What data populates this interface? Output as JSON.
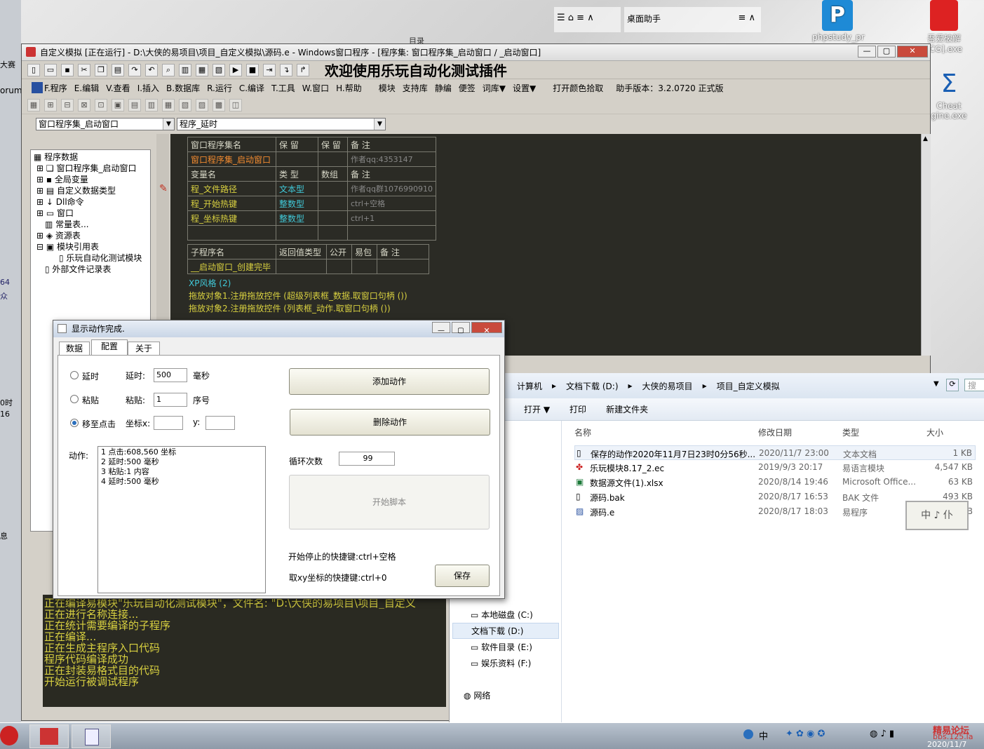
{
  "desktop": {
    "icons": [
      {
        "label": "phpstudy_pr"
      },
      {
        "label": "吾爱破解"
      },
      {
        "label": "[CG].exe"
      },
      {
        "label": "Cheat"
      },
      {
        "label": "gine.exe"
      }
    ],
    "top_label": "目录",
    "assistant_label": "桌面助手",
    "left_fragments": [
      "大赛(窦",
      "orum",
      "64",
      "众",
      "0时",
      "16",
      "息"
    ]
  },
  "ide": {
    "title": "自定义模拟 [正在运行] - D:\\大侠的易项目\\项目_自定义模拟\\源码.e - Windows窗口程序 - [程序集: 窗口程序集_启动窗口 / _启动窗口]",
    "banner": "欢迎使用乐玩自动化测试插件",
    "menu": [
      "F.程序",
      "E.编辑",
      "V.查看",
      "I.插入",
      "B.数据库",
      "R.运行",
      "C.编译",
      "T.工具",
      "W.窗口",
      "H.帮助",
      "模块",
      "支持库",
      "静编",
      "便签",
      "词库▼",
      "设置▼",
      "打开颜色拾取",
      "助手版本：3.2.0720 正式版"
    ],
    "combo1": "窗口程序集_启动窗口",
    "combo2": "程序_延时",
    "tree": [
      "程序数据",
      "窗口程序集_启动窗口",
      "全局变量",
      "自定义数据类型",
      "Dll命令",
      "窗口",
      "常量表...",
      "资源表",
      "模块引用表",
      "乐玩自动化测试模块",
      "外部文件记录表"
    ],
    "table1": {
      "header": [
        "窗口程序集名",
        "保 留",
        "保 留",
        "备 注"
      ],
      "row": [
        "窗口程序集_启动窗口",
        "",
        "",
        "作者qq:4353147"
      ],
      "var_header": [
        "变量名",
        "类 型",
        "数组",
        "备 注"
      ],
      "vars": [
        [
          "程_文件路径",
          "文本型",
          "",
          "作者qq群1076990910"
        ],
        [
          "程_开始热键",
          "整数型",
          "",
          "ctrl+空格"
        ],
        [
          "程_坐标热键",
          "整数型",
          "",
          "ctrl+1"
        ]
      ]
    },
    "table2": {
      "header": [
        "子程序名",
        "返回值类型",
        "公开",
        "易包",
        "备 注"
      ],
      "row": [
        "__启动窗口_创建完毕",
        "",
        "",
        "",
        ""
      ]
    },
    "code_lines": [
      "XP风格 (2)",
      "拖放对象1.注册拖放控件 (超级列表框_数据.取窗口句柄 ())",
      "拖放对象2.注册拖放控件 (列表框_动作.取窗口句柄 ())"
    ],
    "output_lines": [
      "正在编译易模块\"乐玩自动化测试模块\"，文件名: \"D:\\大侠的易项目\\项目_自定义",
      "正在进行名称连接...",
      "正在统计需要编译的子程序",
      "正在编译...",
      "正在生成主程序入口代码",
      "程序代码编译成功",
      "正在封装易格式目的代码",
      "开始运行被调试程序"
    ]
  },
  "dialog": {
    "title": "显示动作完成.",
    "tabs": [
      "数据",
      "配置",
      "关于"
    ],
    "radio_delay": "延时",
    "radio_paste": "粘贴",
    "radio_move": "移至点击",
    "delay_label": "延时:",
    "delay_value": "500",
    "delay_unit": "毫秒",
    "paste_label": "粘贴:",
    "paste_value": "1",
    "paste_unit": "序号",
    "coord_label": "坐标x:",
    "coord_x": "",
    "y_label": "y:",
    "coord_y": "",
    "action_label": "动作:",
    "actions": [
      "1 点击:608,560 坐标",
      "2 延时:500 毫秒",
      "3 粘贴:1 内容",
      "4 延时:500 毫秒"
    ],
    "add_btn": "添加动作",
    "del_btn": "删除动作",
    "loop_label": "循环次数",
    "loop_value": "99",
    "start_btn": "开始脚本",
    "hotkey1": "开始停止的快捷键:ctrl+空格",
    "hotkey2": "取xy坐标的快捷键:ctrl+0",
    "save_btn": "保存"
  },
  "explorer": {
    "path": [
      "计算机",
      "文档下载 (D:)",
      "大侠的易项目",
      "项目_自定义模拟"
    ],
    "search_placeholder": "搜",
    "cmd": [
      "打开 ▼",
      "打印",
      "新建文件夹"
    ],
    "columns": [
      "名称",
      "修改日期",
      "类型",
      "大小"
    ],
    "files": [
      {
        "name": "保存的动作2020年11月7日23时0分56秒...",
        "date": "2020/11/7 23:00",
        "type": "文本文档",
        "size": "1 KB"
      },
      {
        "name": "乐玩模块8.17_2.ec",
        "date": "2019/9/3 20:17",
        "type": "易语言模块",
        "size": "4,547 KB"
      },
      {
        "name": "数据源文件(1).xlsx",
        "date": "2020/8/14 19:46",
        "type": "Microsoft Office...",
        "size": "63 KB"
      },
      {
        "name": "源码.bak",
        "date": "2020/8/17 16:53",
        "type": "BAK 文件",
        "size": "493 KB"
      },
      {
        "name": "源码.e",
        "date": "2020/8/17 18:03",
        "type": "易程序",
        "size": "KB"
      }
    ],
    "drives": [
      "本地磁盘 (C:)",
      "文档下载 (D:)",
      "软件目录 (E:)",
      "娱乐资料 (F:)"
    ],
    "network": "网络",
    "ime": "中 ♪ 仆"
  },
  "taskbar": {
    "ime": "中",
    "watermark": "精易论坛",
    "watermark2": "bbs.125.la",
    "date": "2020/11/7"
  },
  "colors": {
    "accent": "#2a6fbd",
    "code_bg": "#2b2b25",
    "orange": "#f08a30",
    "yellow": "#d8d040",
    "cyan": "#40c8d8"
  }
}
